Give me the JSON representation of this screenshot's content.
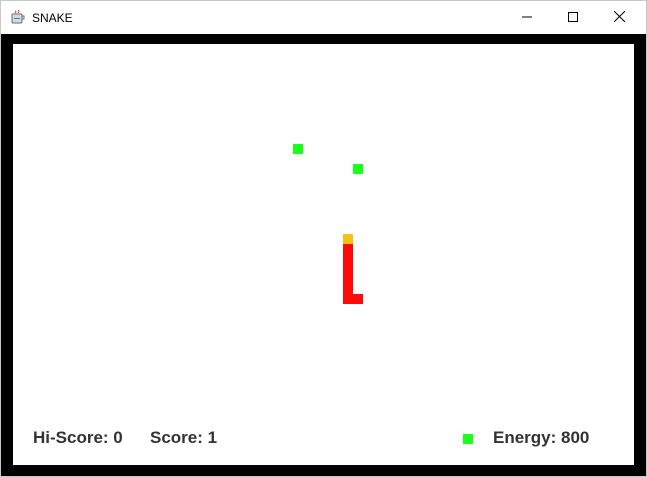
{
  "window": {
    "title": "SNAKE",
    "controls": [
      "minimize",
      "maximize",
      "close"
    ]
  },
  "game": {
    "board_background": "#ffffff",
    "frame_color": "#000000",
    "snake": {
      "head_color": "#f5c211",
      "body_color": "#ff0a0a"
    },
    "food": {
      "color": "#19ff19",
      "count": 2
    }
  },
  "hud": {
    "hiscore": "Hi-Score: 0",
    "score": "Score: 1",
    "energy": "Energy: 800",
    "energy_icon_color": "#19ff19"
  }
}
